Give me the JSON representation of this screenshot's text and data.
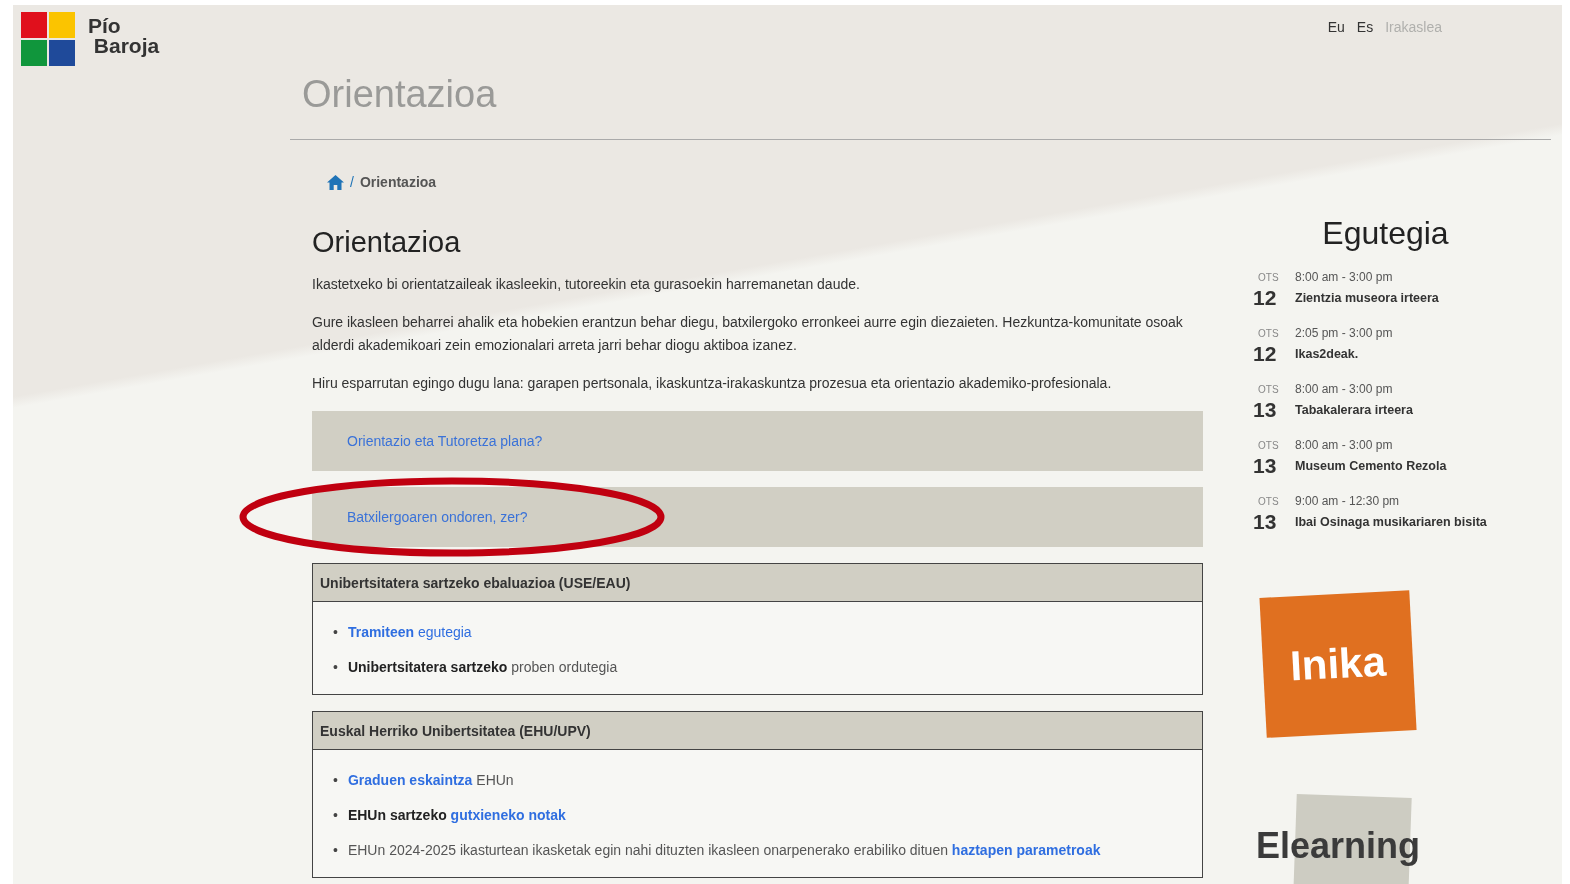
{
  "logo": {
    "line1": "Pío",
    "line2": "Baroja"
  },
  "top_links": [
    {
      "label": "Eu",
      "disabled": false
    },
    {
      "label": "Es",
      "disabled": false
    },
    {
      "label": "Irakaslea",
      "disabled": true
    }
  ],
  "page_title": "Orientazioa",
  "breadcrumb": {
    "separator": "/",
    "current": "Orientazioa"
  },
  "heading": "Orientazioa",
  "paragraphs": [
    "Ikastetxeko bi orientatzaileak ikasleekin, tutoreekin eta gurasoekin harremanetan daude.",
    "Gure ikasleen beharrei ahalik eta hobekien erantzun behar diegu, batxilergoko erronkeei aurre egin diezaieten. Hezkuntza-komunitate osoak alderdi akademikoari zein emozionalari arreta jarri behar diogu aktiboa izanez.",
    "Hiru esparrutan egingo dugu lana: garapen pertsonala, ikaskuntza-irakaskuntza prozesua eta orientazio akademiko-profesionala."
  ],
  "accordion": [
    {
      "label": "Orientazio eta Tutoretza plana?",
      "circled": false
    },
    {
      "label": "Batxilergoaren ondoren, zer?",
      "circled": true
    }
  ],
  "cards": [
    {
      "title": "Unibertsitatera sartzeko ebaluazioa (USE/EAU)",
      "items": [
        {
          "bullet": "•",
          "segments": [
            {
              "text": "Tramiteen",
              "kind": "bold_link"
            },
            {
              "text": " egutegia",
              "kind": "link"
            }
          ]
        },
        {
          "bullet": "•",
          "segments": [
            {
              "text": "Unibertsitatera sartzeko",
              "kind": "bold"
            },
            {
              "text": " proben ordutegia",
              "kind": "text"
            }
          ]
        }
      ]
    },
    {
      "title": "Euskal Herriko Unibertsitatea (EHU/UPV)",
      "items": [
        {
          "bullet": "•",
          "segments": [
            {
              "text": "Graduen eskaintza",
              "kind": "bold_link"
            },
            {
              "text": " EHUn",
              "kind": "text"
            }
          ]
        },
        {
          "bullet": "•",
          "segments": [
            {
              "text": "EHUn sartzeko ",
              "kind": "bold"
            },
            {
              "text": "gutxieneko notak",
              "kind": "bold_link"
            }
          ]
        },
        {
          "bullet": "•",
          "segments": [
            {
              "text": "EHUn 2024-2025 ikasturtean ikasketak egin nahi dituzten ikasleen onarpenerako erabiliko dituen ",
              "kind": "text"
            },
            {
              "text": "haztapen parametroak",
              "kind": "bold_link"
            }
          ]
        }
      ]
    }
  ],
  "calendar": {
    "title": "Egutegia",
    "events": [
      {
        "month": "OTS",
        "day": "12",
        "time": "8:00 am - 3:00 pm",
        "title": "Zientzia museora irteera"
      },
      {
        "month": "OTS",
        "day": "12",
        "time": "2:05 pm - 3:00 pm",
        "title": "Ikas2deak."
      },
      {
        "month": "OTS",
        "day": "13",
        "time": "8:00 am - 3:00 pm",
        "title": "Tabakalerara irteera"
      },
      {
        "month": "OTS",
        "day": "13",
        "time": "8:00 am - 3:00 pm",
        "title": "Museum Cemento Rezola"
      },
      {
        "month": "OTS",
        "day": "13",
        "time": "9:00 am - 12:30 pm",
        "title": "Ibai Osinaga musikariaren bisita"
      }
    ]
  },
  "banners": [
    {
      "kind": "orange",
      "label": "Inika"
    },
    {
      "kind": "grey",
      "label": "Elearning"
    }
  ]
}
